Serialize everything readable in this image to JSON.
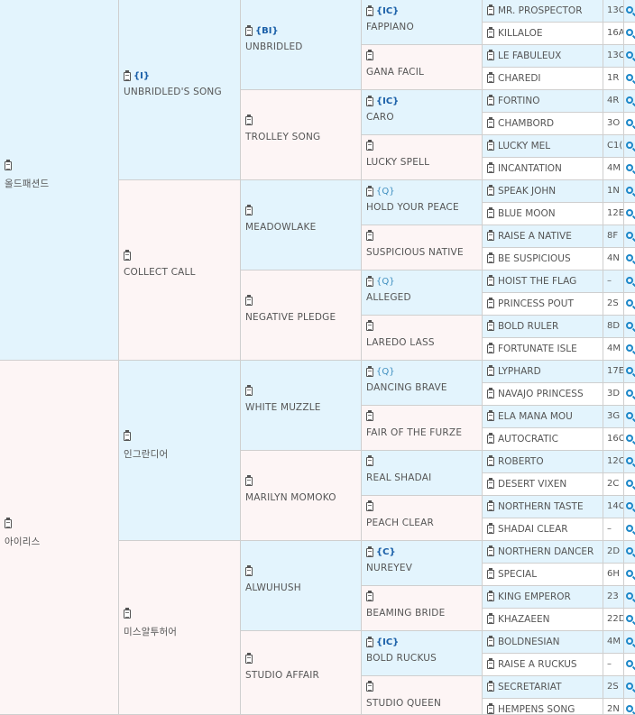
{
  "g1": [
    {
      "name": "올드패션드",
      "badge": ""
    },
    {
      "name": "아이리스",
      "badge": ""
    }
  ],
  "g2": [
    {
      "name": "UNBRIDLED'S SONG",
      "badge": "{I}"
    },
    {
      "name": "COLLECT CALL",
      "badge": ""
    },
    {
      "name": "인그란디어",
      "badge": ""
    },
    {
      "name": "미스알투허어",
      "badge": ""
    }
  ],
  "g3": [
    {
      "name": "UNBRIDLED",
      "badge": "{BI}"
    },
    {
      "name": "TROLLEY SONG",
      "badge": ""
    },
    {
      "name": "MEADOWLAKE",
      "badge": ""
    },
    {
      "name": "NEGATIVE PLEDGE",
      "badge": ""
    },
    {
      "name": "WHITE MUZZLE",
      "badge": ""
    },
    {
      "name": "MARILYN MOMOKO",
      "badge": ""
    },
    {
      "name": "ALWUHUSH",
      "badge": ""
    },
    {
      "name": "STUDIO AFFAIR",
      "badge": ""
    }
  ],
  "g4": [
    {
      "name": "FAPPIANO",
      "badge": "{IC}"
    },
    {
      "name": "GANA FACIL",
      "badge": ""
    },
    {
      "name": "CARO",
      "badge": "{IC}"
    },
    {
      "name": "LUCKY SPELL",
      "badge": ""
    },
    {
      "name": "HOLD YOUR PEACE",
      "badge": "{Q}"
    },
    {
      "name": "SUSPICIOUS NATIVE",
      "badge": ""
    },
    {
      "name": "ALLEGED",
      "badge": "{Q}"
    },
    {
      "name": "LAREDO LASS",
      "badge": ""
    },
    {
      "name": "DANCING BRAVE",
      "badge": "{Q}"
    },
    {
      "name": "FAIR OF THE FURZE",
      "badge": ""
    },
    {
      "name": "REAL SHADAI",
      "badge": ""
    },
    {
      "name": "PEACH CLEAR",
      "badge": ""
    },
    {
      "name": "NUREYEV",
      "badge": "{C}"
    },
    {
      "name": "BEAMING BRIDE",
      "badge": ""
    },
    {
      "name": "BOLD RUCKUS",
      "badge": "{IC}"
    },
    {
      "name": "STUDIO QUEEN",
      "badge": ""
    }
  ],
  "g5": [
    {
      "name": "MR. PROSPECTOR",
      "code": "13C"
    },
    {
      "name": "KILLALOE",
      "code": "16A"
    },
    {
      "name": "LE FABULEUX",
      "code": "13C"
    },
    {
      "name": "CHAREDI",
      "code": "1R"
    },
    {
      "name": "FORTINO",
      "code": "4R"
    },
    {
      "name": "CHAMBORD",
      "code": "3O"
    },
    {
      "name": "LUCKY MEL",
      "code": "C1("
    },
    {
      "name": "INCANTATION",
      "code": "4M"
    },
    {
      "name": "SPEAK JOHN",
      "code": "1N"
    },
    {
      "name": "BLUE MOON",
      "code": "12E"
    },
    {
      "name": "RAISE A NATIVE",
      "code": "8F"
    },
    {
      "name": "BE SUSPICIOUS",
      "code": "4N"
    },
    {
      "name": "HOIST THE FLAG",
      "code": "–"
    },
    {
      "name": "PRINCESS POUT",
      "code": "2S"
    },
    {
      "name": "BOLD RULER",
      "code": "8D"
    },
    {
      "name": "FORTUNATE ISLE",
      "code": "4M"
    },
    {
      "name": "LYPHARD",
      "code": "17E"
    },
    {
      "name": "NAVAJO PRINCESS",
      "code": "3D"
    },
    {
      "name": "ELA MANA MOU",
      "code": "3G"
    },
    {
      "name": "AUTOCRATIC",
      "code": "16C"
    },
    {
      "name": "ROBERTO",
      "code": "12C"
    },
    {
      "name": "DESERT VIXEN",
      "code": "2C"
    },
    {
      "name": "NORTHERN TASTE",
      "code": "14C"
    },
    {
      "name": "SHADAI CLEAR",
      "code": "–"
    },
    {
      "name": "NORTHERN DANCER",
      "code": "2D"
    },
    {
      "name": "SPECIAL",
      "code": "6H"
    },
    {
      "name": "KING EMPEROR",
      "code": "23"
    },
    {
      "name": "KHAZAEEN",
      "code": "22D"
    },
    {
      "name": "BOLDNESIAN",
      "code": "4M"
    },
    {
      "name": "RAISE A RUCKUS",
      "code": "–"
    },
    {
      "name": "SECRETARIAT",
      "code": "2S"
    },
    {
      "name": "HEMPENS SONG",
      "code": "2N"
    }
  ],
  "icons": {
    "record": "clipboard-icon",
    "search": "magnifier-icon"
  },
  "colors": {
    "male_bg": "#e3f4fd",
    "female_bg": "#fdf5f5",
    "badge": "#1a5fa8",
    "search": "#1e88c8"
  }
}
